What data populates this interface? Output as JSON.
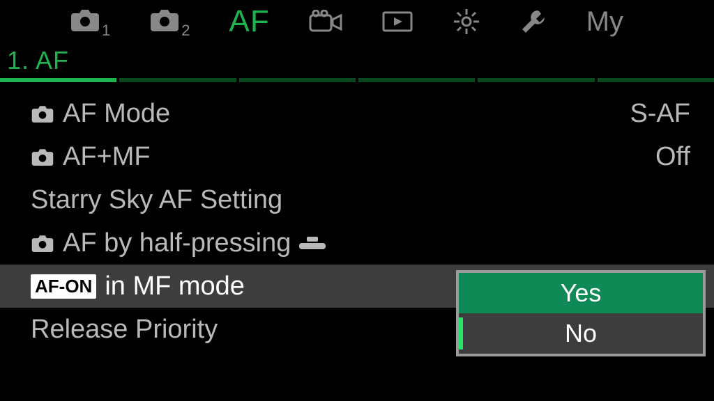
{
  "tabs": {
    "cam1_sub": "1",
    "cam2_sub": "2",
    "af_label": "AF",
    "my_label": "My"
  },
  "section": {
    "title": "1. AF"
  },
  "rows": [
    {
      "label": "AF Mode",
      "value": "S-AF"
    },
    {
      "label": "AF+MF",
      "value": "Off"
    },
    {
      "label": "Starry Sky AF Setting",
      "value": ""
    },
    {
      "label": "AF by half-pressing",
      "value": ""
    },
    {
      "label": "in MF mode",
      "value": ""
    },
    {
      "label": "Release Priority",
      "value": ""
    }
  ],
  "popup": {
    "yes": "Yes",
    "no": "No"
  }
}
